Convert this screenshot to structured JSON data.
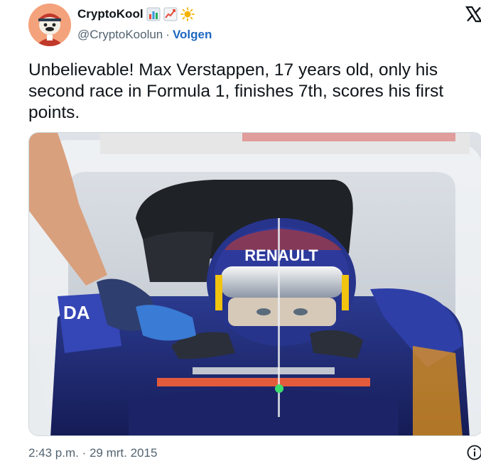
{
  "author": {
    "display_name": "CryptoKool",
    "handle": "@CryptoKoolun",
    "separator": "·",
    "follow_label": "Volgen",
    "badges": [
      "bar-chart-emoji",
      "chart-increasing-emoji",
      "sun-emoji"
    ]
  },
  "tweet": {
    "text": "Unbelievable! Max Verstappen, 17 years old, only his second race in Formula 1, finishes 7th, scores his first points."
  },
  "media": {
    "helmet_brand": "RENAULT",
    "car_text": "DA"
  },
  "footer": {
    "timestamp": "2:43 p.m. · 29 mrt. 2015"
  },
  "icons": {
    "platform_logo": "x-logo-icon",
    "info": "info-icon"
  },
  "colors": {
    "link": "#1d67c0",
    "secondary_text": "#536471",
    "primary_text": "#0f1419"
  }
}
